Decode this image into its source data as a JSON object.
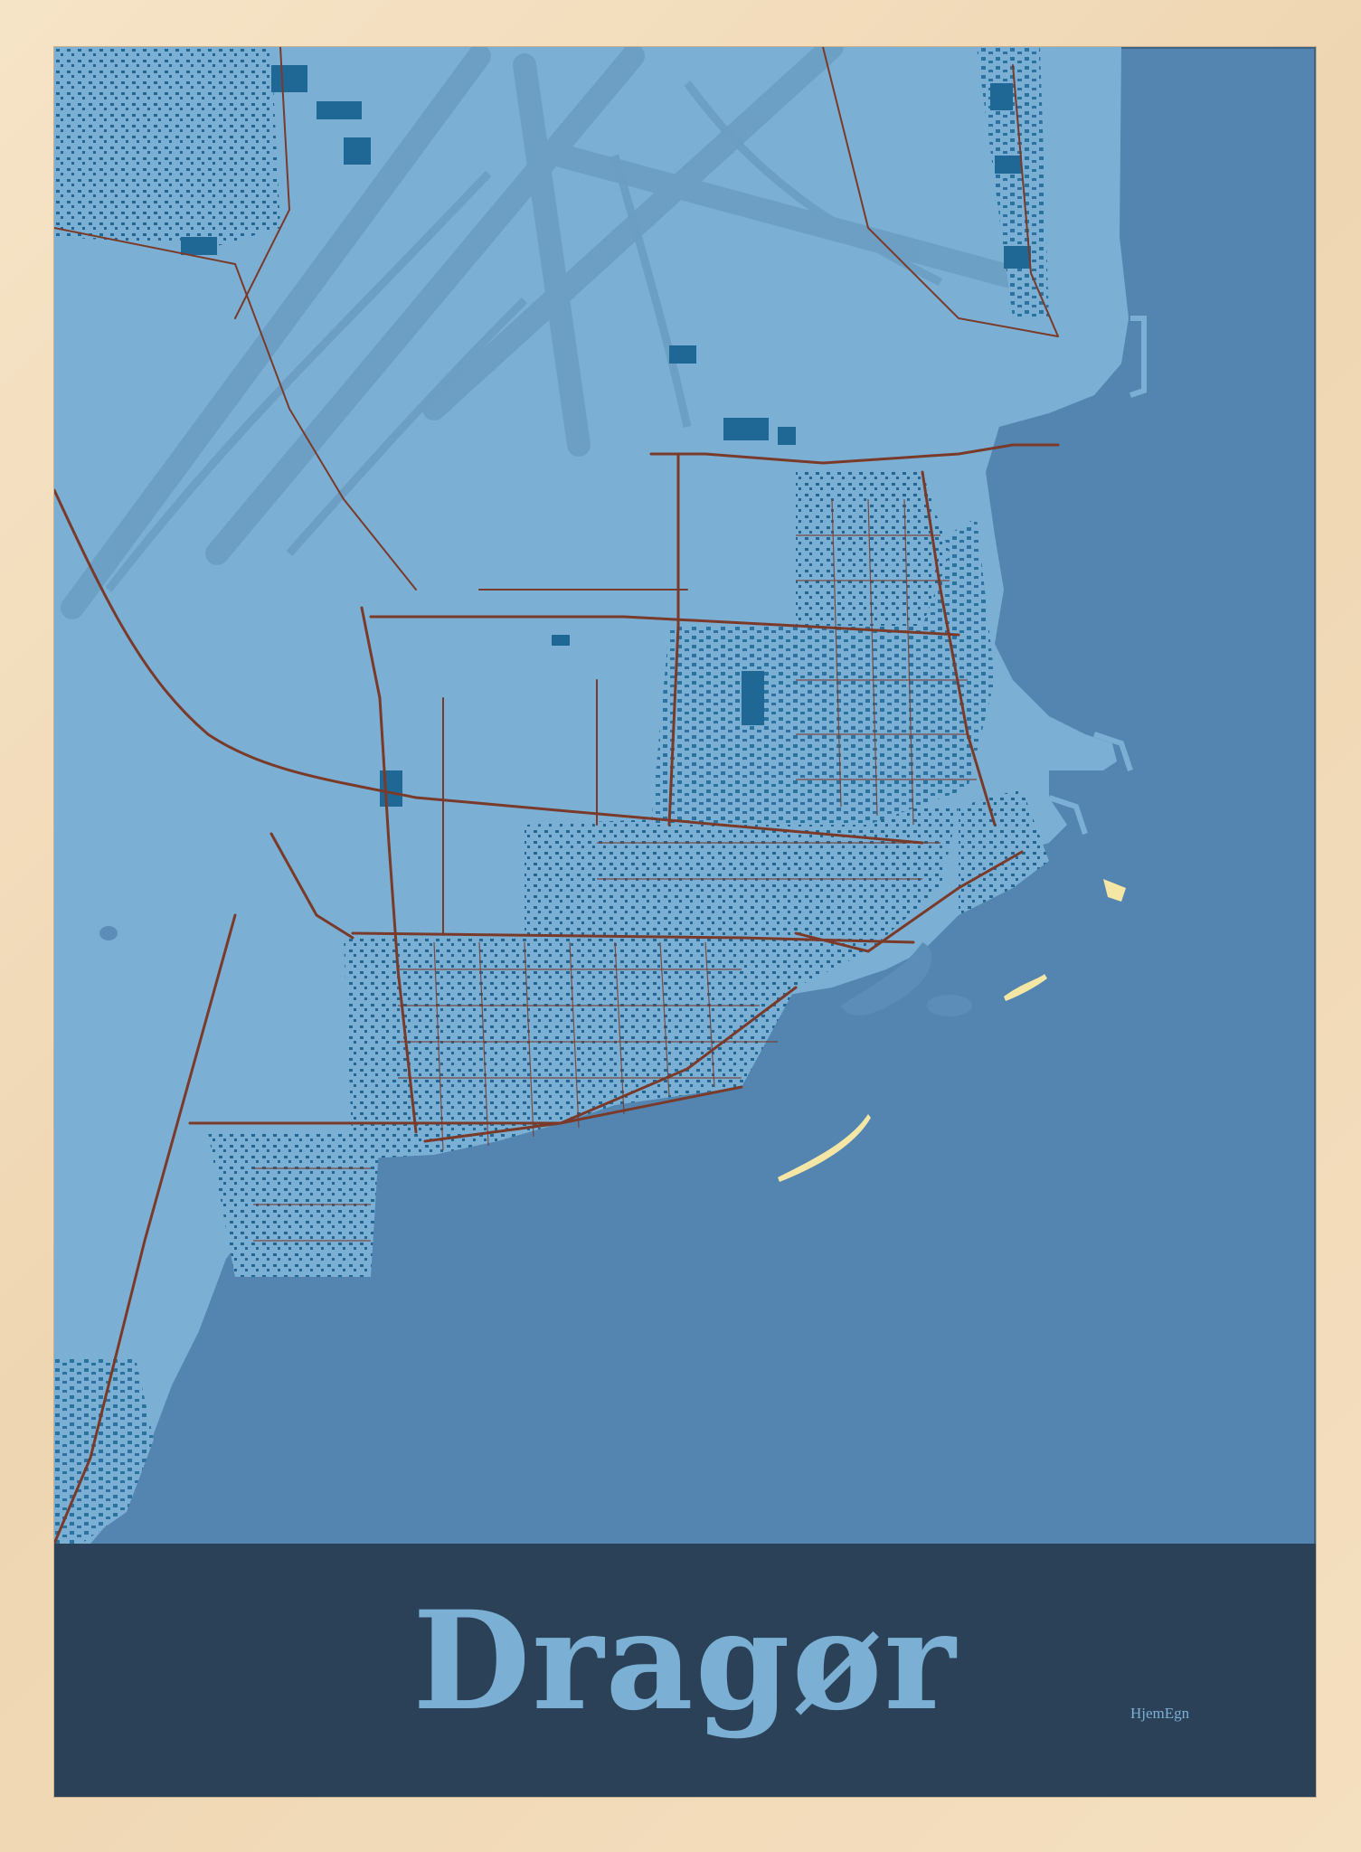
{
  "poster": {
    "title": "Dragør",
    "brand": "HjemEgn"
  },
  "colors": {
    "frame": "#f1dcbc",
    "sea": "#5484b0",
    "land": "#7bb0d4",
    "buildings": "#1f6895",
    "roads": "#7a3a2a",
    "runways": "#6c9ec3",
    "beach": "#f4e7a6",
    "band": "#2b4158",
    "title_text": "#7bb0d4"
  },
  "icons": {
    "map": "street-map-illustration"
  }
}
